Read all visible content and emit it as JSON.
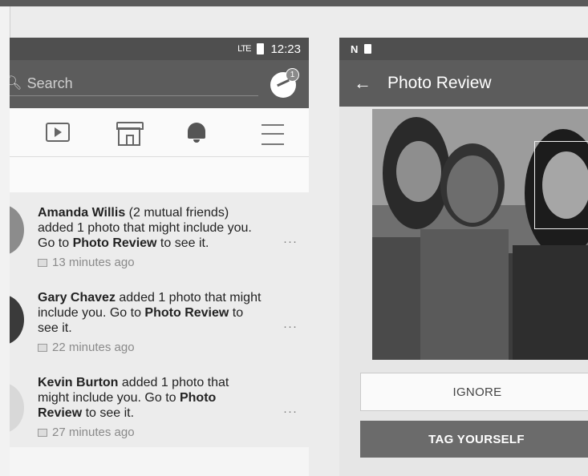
{
  "left_phone": {
    "status": {
      "signal": "LTE",
      "time": "12:23"
    },
    "search": {
      "placeholder": "Search"
    },
    "messenger_badge": "1",
    "notifications": [
      {
        "segments": [
          {
            "text": "Amanda Willis",
            "bold": true
          },
          {
            "text": " (2 mutual friends) added 1 photo that might include you. Go to ",
            "bold": false
          },
          {
            "text": "Photo Review",
            "bold": true
          },
          {
            "text": " to see it.",
            "bold": false
          }
        ],
        "time": "13 minutes ago"
      },
      {
        "segments": [
          {
            "text": "Gary Chavez",
            "bold": true
          },
          {
            "text": " added 1 photo that might include you. Go to ",
            "bold": false
          },
          {
            "text": "Photo Review",
            "bold": true
          },
          {
            "text": " to see it.",
            "bold": false
          }
        ],
        "time": "22 minutes ago"
      },
      {
        "segments": [
          {
            "text": "Kevin Burton",
            "bold": true
          },
          {
            "text": " added 1 photo that might include you. Go to ",
            "bold": false
          },
          {
            "text": "Photo Review",
            "bold": true
          },
          {
            "text": " to see it.",
            "bold": false
          }
        ],
        "time": "27 minutes ago"
      }
    ],
    "more_label": "···"
  },
  "right_phone": {
    "status": {
      "icons": [
        "n-icon",
        "sd-card-icon"
      ],
      "n_glyph": "N"
    },
    "appbar": {
      "back_glyph": "←",
      "title": "Photo Review"
    },
    "buttons": {
      "ignore": "IGNORE",
      "tag": "TAG YOURSELF"
    }
  }
}
